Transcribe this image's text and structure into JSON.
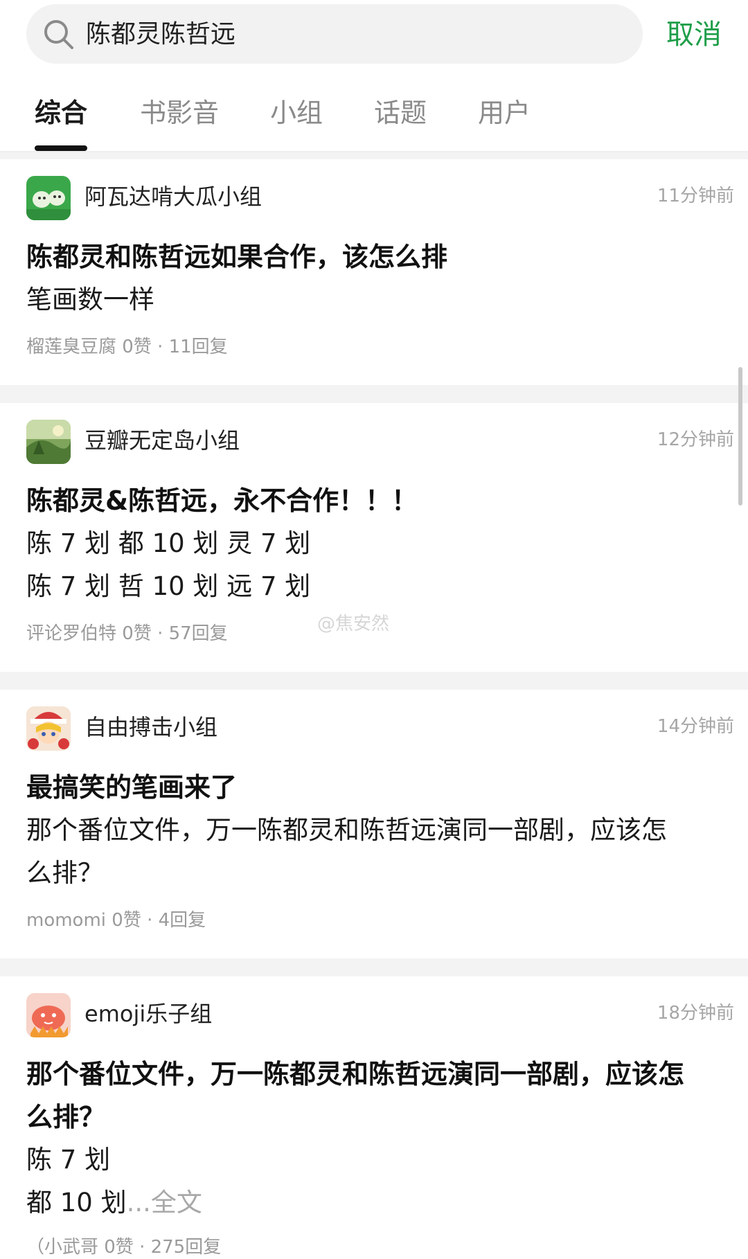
{
  "search": {
    "query": "陈都灵陈哲远",
    "cancel_label": "取消"
  },
  "tabs": [
    {
      "label": "综合",
      "active": true
    },
    {
      "label": "书影音",
      "active": false
    },
    {
      "label": "小组",
      "active": false
    },
    {
      "label": "话题",
      "active": false
    },
    {
      "label": "用户",
      "active": false
    }
  ],
  "watermark": "@焦安然",
  "posts": [
    {
      "group": "阿瓦达啃大瓜小组",
      "time": "11分钟前",
      "title": "陈都灵和陈哲远如果合作，该怎么排",
      "body": [
        "笔画数一样"
      ],
      "meta": "榴莲臭豆腐 0赞 · 11回复",
      "avatar": "green-melon-avatar"
    },
    {
      "group": "豆瓣无定岛小组",
      "time": "12分钟前",
      "title": "陈都灵&陈哲远，永不合作！！！",
      "body": [
        "陈 7 划  都 10 划  灵 7 划",
        "陈 7 划  哲 10 划  远 7 划"
      ],
      "meta": "评论罗伯特 0赞 · 57回复",
      "avatar": "forest-avatar"
    },
    {
      "group": "自由搏击小组",
      "time": "14分钟前",
      "title": "最搞笑的笔画来了",
      "body": [
        "那个番位文件，万一陈都灵和陈哲远演同一部剧，应该怎",
        "么排？"
      ],
      "meta": "momomi 0赞 · 4回复",
      "avatar": "anime-girl-avatar"
    },
    {
      "group": "emoji乐子组",
      "time": "18分钟前",
      "title_lines": [
        "那个番位文件，万一陈都灵和陈哲远演同一部剧，应该怎",
        "么排？"
      ],
      "body": [
        "陈 7 划"
      ],
      "last_line": "都 10 划",
      "more_label": "...全文",
      "meta": "（小武哥 0赞 · 275回复",
      "avatar": "red-crab-avatar"
    }
  ]
}
